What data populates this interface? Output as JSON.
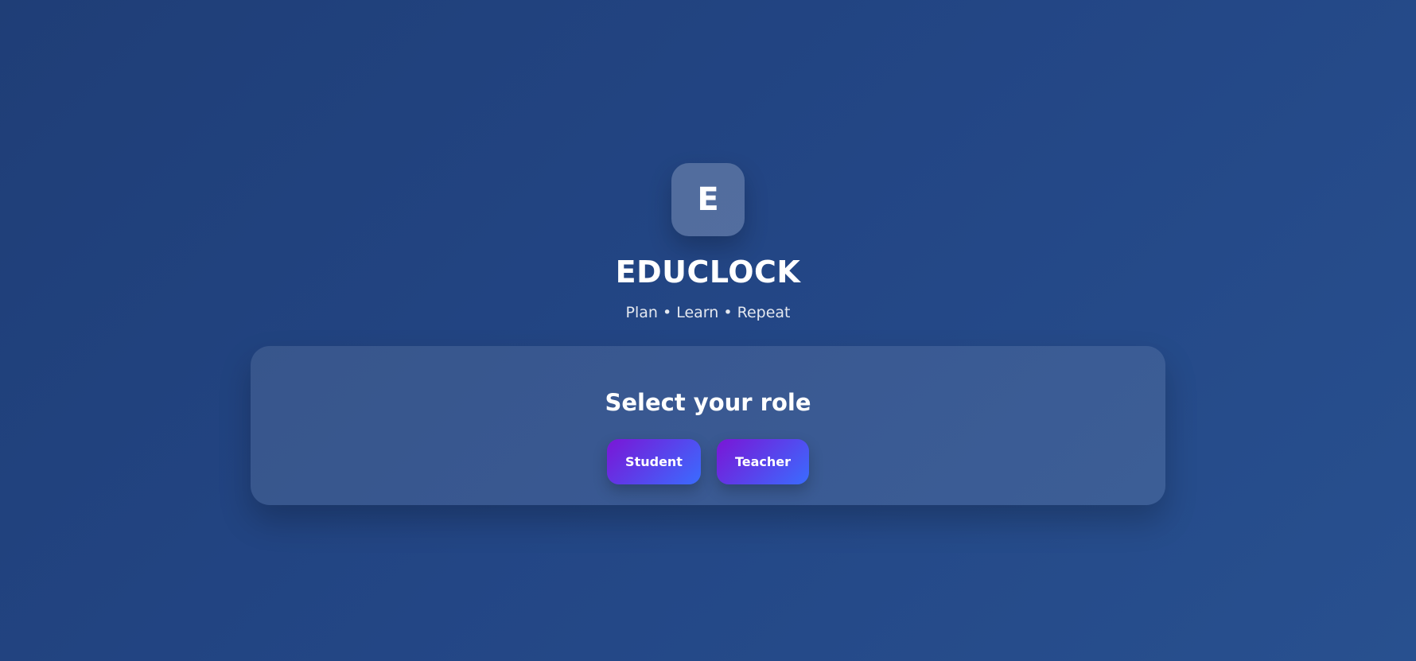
{
  "brand": {
    "logo_letter": "E",
    "app_name": "EDUCLOCK",
    "tagline": "Plan • Learn • Repeat"
  },
  "role_selection": {
    "heading": "Select your role",
    "options": [
      {
        "label": "Student"
      },
      {
        "label": "Teacher"
      }
    ]
  },
  "colors": {
    "background_start": "#1f3e77",
    "background_end": "#28508f",
    "button_gradient_start": "#7a16d6",
    "button_gradient_end": "#3a6cff",
    "text": "#ffffff"
  }
}
